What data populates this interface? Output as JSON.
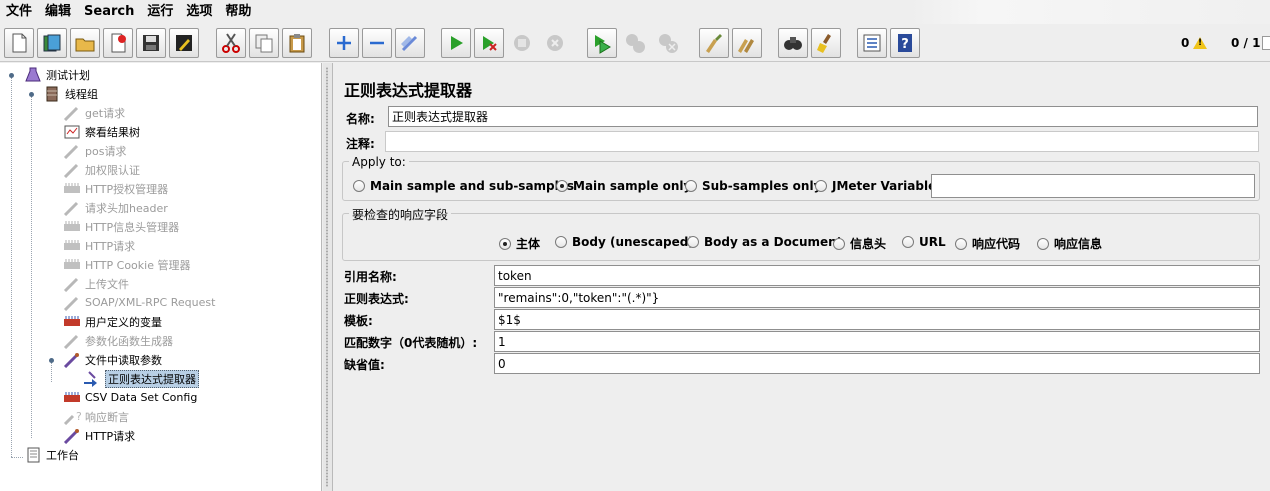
{
  "menu": [
    "文件",
    "编辑",
    "Search",
    "运行",
    "选项",
    "帮助"
  ],
  "toolbar": {
    "buttons": [
      "new-icon",
      "templates-icon",
      "open-icon",
      "close-icon",
      "save-icon",
      "save-as-icon",
      "cut-icon",
      "copy-icon",
      "paste-icon",
      "expand-icon",
      "collapse-icon",
      "toggle-icon",
      "start-icon",
      "start-no-pause-icon",
      "stop-icon",
      "shutdown-icon",
      "remote-start-icon",
      "remote-stop-icon",
      "remote-shutdown-icon",
      "clear-icon",
      "clear-all-icon",
      "search-icon",
      "reset-search-icon",
      "function-helper-icon",
      "help-icon"
    ],
    "warnings": "0",
    "threads": "0 / 1"
  },
  "tree": {
    "nodes": [
      {
        "label": "测试计划",
        "icon": "test-plan-icon",
        "disabled": false
      },
      {
        "label": "线程组",
        "icon": "thread-group-icon",
        "disabled": false
      },
      {
        "label": "get请求",
        "icon": "sampler-icon",
        "disabled": true
      },
      {
        "label": "察看结果树",
        "icon": "listener-icon",
        "disabled": false
      },
      {
        "label": "pos请求",
        "icon": "sampler-icon",
        "disabled": true
      },
      {
        "label": "加权限认证",
        "icon": "sampler-icon",
        "disabled": true
      },
      {
        "label": "HTTP授权管理器",
        "icon": "config-icon",
        "disabled": true
      },
      {
        "label": "请求头加header",
        "icon": "sampler-icon",
        "disabled": true
      },
      {
        "label": "HTTP信息头管理器",
        "icon": "config-icon",
        "disabled": true
      },
      {
        "label": "HTTP请求",
        "icon": "config-icon",
        "disabled": true
      },
      {
        "label": "HTTP Cookie 管理器",
        "icon": "config-icon",
        "disabled": true
      },
      {
        "label": "上传文件",
        "icon": "sampler-icon",
        "disabled": true
      },
      {
        "label": "SOAP/XML-RPC Request",
        "icon": "sampler-icon",
        "disabled": true
      },
      {
        "label": "用户定义的变量",
        "icon": "config-active-icon",
        "disabled": false
      },
      {
        "label": "参数化函数生成器",
        "icon": "sampler-icon",
        "disabled": true
      },
      {
        "label": "文件中读取参数",
        "icon": "sampler-active-icon",
        "disabled": false
      },
      {
        "label": "正则表达式提取器",
        "icon": "post-processor-icon",
        "disabled": false,
        "selected": true
      },
      {
        "label": "CSV Data Set Config",
        "icon": "config-active-icon",
        "disabled": false
      },
      {
        "label": "响应断言",
        "icon": "assertion-icon",
        "disabled": true
      },
      {
        "label": "HTTP请求",
        "icon": "sampler-active-icon",
        "disabled": false
      },
      {
        "label": "工作台",
        "icon": "workbench-icon",
        "disabled": false
      }
    ]
  },
  "panel": {
    "title": "正则表达式提取器",
    "name_label": "名称:",
    "name_value": "正则表达式提取器",
    "comment_label": "注释:",
    "comment_value": "",
    "apply_to": {
      "title": "Apply to:",
      "options": [
        "Main sample and sub-samples",
        "Main sample only",
        "Sub-samples only",
        "JMeter Variable"
      ],
      "selected": "Main sample only",
      "variable_value": ""
    },
    "field_to_check": {
      "title": "要检查的响应字段",
      "options": [
        "主体",
        "Body (unescaped)",
        "Body as a Document",
        "信息头",
        "URL",
        "响应代码",
        "响应信息"
      ],
      "selected": "主体"
    },
    "fields": [
      {
        "label": "引用名称:",
        "value": "token"
      },
      {
        "label": "正则表达式:",
        "value": "\"remains\":0,\"token\":\"(.*)\"}"
      },
      {
        "label": "模板:",
        "value": "$1$"
      },
      {
        "label": "匹配数字（0代表随机）:",
        "value": "1"
      },
      {
        "label": "缺省值:",
        "value": "0"
      }
    ]
  }
}
